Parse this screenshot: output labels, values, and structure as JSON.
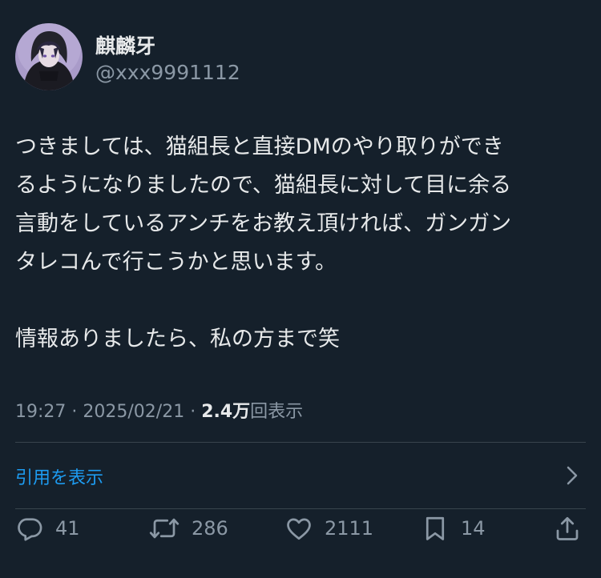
{
  "user": {
    "name": "麒麟牙",
    "handle": "@xxx9991112"
  },
  "tweet": {
    "lines": [
      "つきましては、猫組長と直接DMのやり取りができ",
      "るようになりましたので、猫組長に対して目に余る",
      "言動をしているアンチをお教え頂ければ、ガンガン",
      "タレコんで行こうかと思います。"
    ],
    "second_paragraph": "情報ありましたら、私の方まで笑"
  },
  "meta": {
    "time": "19:27",
    "separator1": " · ",
    "date": "2025/02/21",
    "separator2": " · ",
    "views_count": "2.4万",
    "views_label": "回表示"
  },
  "quote": {
    "label": "引用を表示"
  },
  "actions": {
    "replies": "41",
    "retweets": "286",
    "likes": "2111",
    "bookmarks": "14"
  },
  "icons": {
    "reply": "reply-icon",
    "retweet": "retweet-icon",
    "like": "heart-icon",
    "bookmark": "bookmark-icon",
    "share": "share-icon",
    "chevron": "chevron-right-icon"
  },
  "colors": {
    "background": "#15202b",
    "text": "#e7e9ea",
    "secondary": "#8b98a5",
    "link": "#1d9bf0",
    "divider": "#38444d"
  }
}
